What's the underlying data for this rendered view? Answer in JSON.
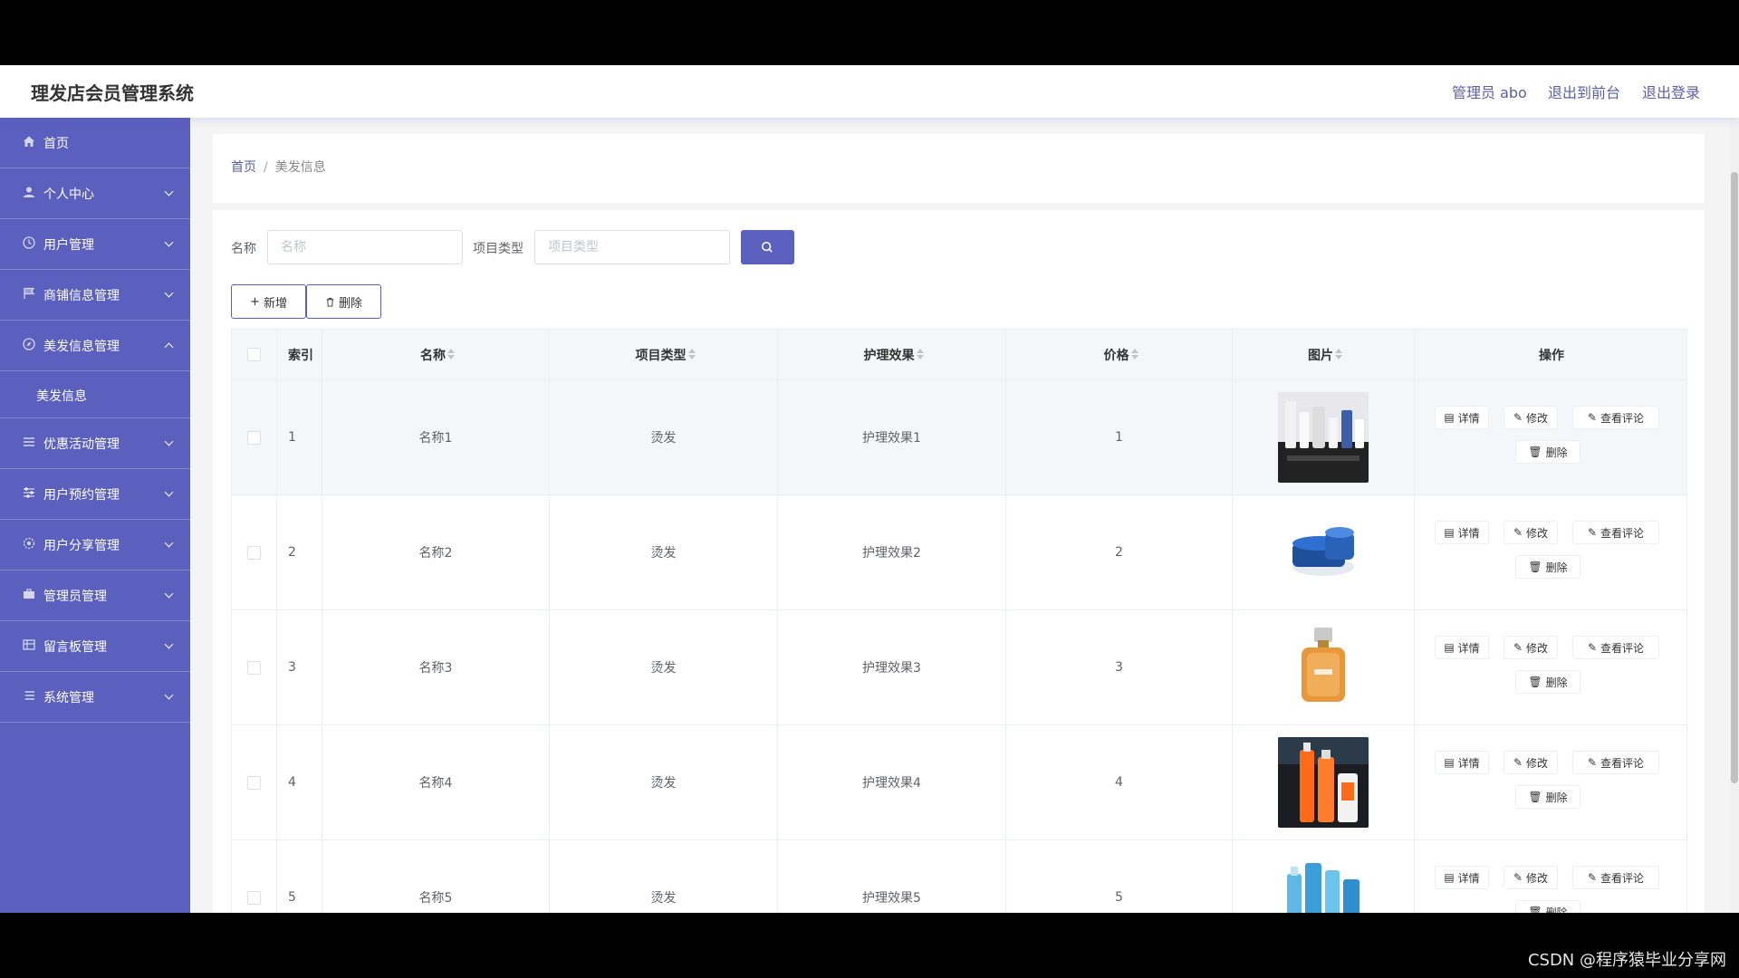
{
  "app": {
    "title": "理发店会员管理系统",
    "user_label": "管理员 abo",
    "back_front": "退出到前台",
    "logout": "退出登录"
  },
  "sidebar": {
    "items": [
      {
        "label": "首页",
        "icon": "home-icon"
      },
      {
        "label": "个人中心",
        "icon": "user-icon"
      },
      {
        "label": "用户管理",
        "icon": "clock-icon"
      },
      {
        "label": "商铺信息管理",
        "icon": "flag-icon"
      },
      {
        "label": "美发信息管理",
        "icon": "compass-icon",
        "expanded": true,
        "sub": "美发信息"
      },
      {
        "label": "优惠活动管理",
        "icon": "list-icon"
      },
      {
        "label": "用户预约管理",
        "icon": "sliders-icon"
      },
      {
        "label": "用户分享管理",
        "icon": "gear-icon"
      },
      {
        "label": "管理员管理",
        "icon": "briefcase-icon"
      },
      {
        "label": "留言板管理",
        "icon": "table-icon"
      },
      {
        "label": "系统管理",
        "icon": "menu-icon"
      }
    ]
  },
  "breadcrumb": {
    "home": "首页",
    "separator": "/",
    "current": "美发信息"
  },
  "search": {
    "name_label": "名称",
    "name_placeholder": "名称",
    "type_label": "项目类型",
    "type_placeholder": "项目类型"
  },
  "toolbar": {
    "add": "新增",
    "delete": "删除"
  },
  "table": {
    "headers": {
      "index": "索引",
      "name": "名称",
      "type": "项目类型",
      "effect": "护理效果",
      "price": "价格",
      "image": "图片",
      "ops": "操作"
    },
    "actions": {
      "detail": "详情",
      "edit": "修改",
      "comments": "查看评论",
      "delete": "删除"
    },
    "rows": [
      {
        "index": "1",
        "name": "名称1",
        "type": "烫发",
        "effect": "护理效果1",
        "price": "1",
        "image": "cosmetics-tray"
      },
      {
        "index": "2",
        "name": "名称2",
        "type": "烫发",
        "effect": "护理效果2",
        "price": "2",
        "image": "blue-cream-jar"
      },
      {
        "index": "3",
        "name": "名称3",
        "type": "烫发",
        "effect": "护理效果3",
        "price": "3",
        "image": "perfume-bottle"
      },
      {
        "index": "4",
        "name": "名称4",
        "type": "烫发",
        "effect": "护理效果4",
        "price": "4",
        "image": "orange-bottles"
      },
      {
        "index": "5",
        "name": "名称5",
        "type": "烫发",
        "effect": "护理效果5",
        "price": "5",
        "image": "blue-bottles"
      }
    ]
  },
  "colors": {
    "sidebar": "#5b5fbd",
    "accent": "#5b5ea6"
  },
  "watermark": "CSDN @程序猿毕业分享网"
}
